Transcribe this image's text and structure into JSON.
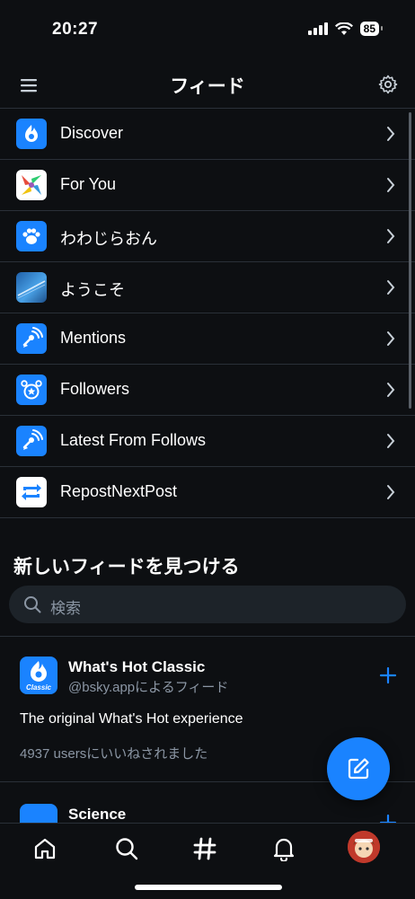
{
  "status": {
    "time": "20:27",
    "battery": "85"
  },
  "header": {
    "title": "フィード"
  },
  "feeds": [
    {
      "label": "Discover",
      "icon": "discover-flame-icon"
    },
    {
      "label": "For You",
      "icon": "for-you-logo-icon"
    },
    {
      "label": "わわじらおん",
      "icon": "paw-icon"
    },
    {
      "label": "ようこそ",
      "icon": "welcome-image-icon"
    },
    {
      "label": "Mentions",
      "icon": "mentions-icon"
    },
    {
      "label": "Followers",
      "icon": "followers-icon"
    },
    {
      "label": "Latest From Follows",
      "icon": "latest-follows-icon"
    },
    {
      "label": "RepostNextPost",
      "icon": "repost-icon"
    }
  ],
  "discover": {
    "title": "新しいフィードを見つける",
    "search_placeholder": "検索"
  },
  "cards": [
    {
      "name": "What's Hot Classic",
      "by": "@bsky.appによるフィード",
      "description": "The original What's Hot experience",
      "likes": "4937 usersにいいねされました",
      "icon_label": "Classic"
    },
    {
      "name": "Science"
    }
  ],
  "tabs": [
    "home",
    "search",
    "feeds",
    "notifications",
    "profile"
  ],
  "colors": {
    "accent": "#1a83ff",
    "background": "#0d0f12",
    "muted": "#8b96a4"
  }
}
